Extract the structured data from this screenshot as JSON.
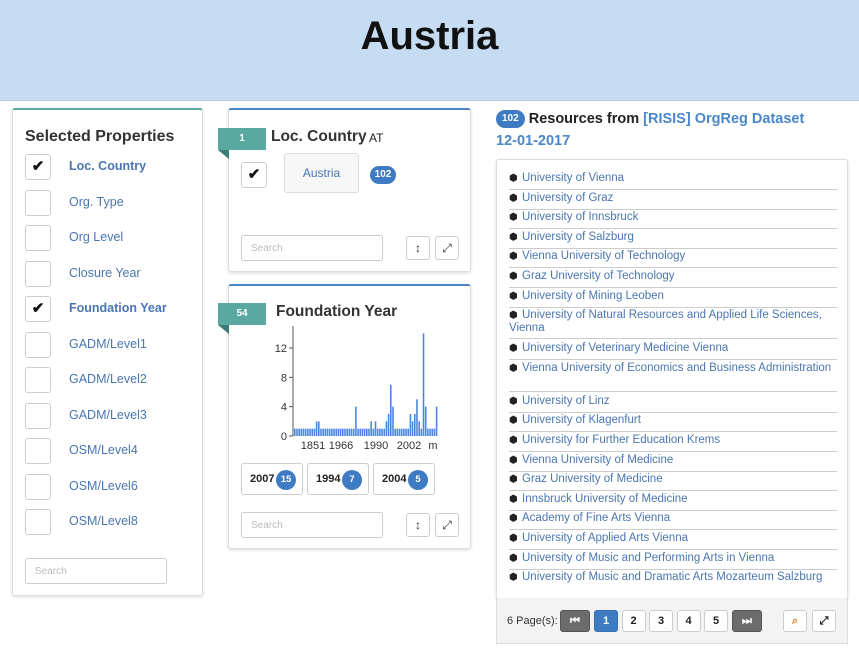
{
  "header": {
    "title": "Austria"
  },
  "properties": {
    "title": "Selected Properties",
    "search_placeholder": "Search",
    "items": [
      {
        "label": "Loc. Country",
        "checked": true
      },
      {
        "label": "Org. Type",
        "checked": false
      },
      {
        "label": "Org Level",
        "checked": false
      },
      {
        "label": "Closure Year",
        "checked": false
      },
      {
        "label": "Foundation Year",
        "checked": true
      },
      {
        "label": "GADM/Level1",
        "checked": false
      },
      {
        "label": "GADM/Level2",
        "checked": false
      },
      {
        "label": "GADM/Level3",
        "checked": false
      },
      {
        "label": "OSM/Level4",
        "checked": false
      },
      {
        "label": "OSM/Level6",
        "checked": false
      },
      {
        "label": "OSM/Level8",
        "checked": false
      }
    ]
  },
  "facet_country": {
    "badge": "1",
    "title": "Loc. Country",
    "subtitle": "AT",
    "value": "Austria",
    "count": "102",
    "search_placeholder": "Search"
  },
  "facet_year": {
    "badge": "54",
    "title": "Foundation Year",
    "search_placeholder": "Search",
    "buttons": [
      {
        "year": "2007",
        "count": "15"
      },
      {
        "year": "1994",
        "count": "7"
      },
      {
        "year": "2004",
        "count": "5"
      }
    ]
  },
  "chart_data": {
    "type": "bar",
    "title": "",
    "xlabel": "",
    "ylabel": "",
    "x_tick_labels": [
      "1851",
      "1966",
      "1990",
      "2002",
      "m"
    ],
    "y_ticks": [
      0,
      4,
      8,
      12
    ],
    "ylim": [
      0,
      15
    ],
    "values": [
      1,
      1,
      1,
      1,
      1,
      1,
      1,
      1,
      1,
      1,
      2,
      2,
      1,
      1,
      1,
      1,
      1,
      1,
      1,
      1,
      1,
      1,
      1,
      1,
      1,
      1,
      1,
      1,
      4,
      1,
      1,
      1,
      1,
      1,
      1,
      2,
      1,
      2,
      1,
      1,
      1,
      1,
      2,
      3,
      7,
      4,
      1,
      1,
      1,
      1,
      1,
      1,
      1,
      3,
      2,
      3,
      5,
      2,
      1,
      14,
      4,
      1,
      1,
      1,
      1,
      4
    ]
  },
  "resources": {
    "count": "102",
    "heading": "Resources from",
    "dataset_link": "[RISIS] OrgReg Dataset",
    "date": "12-01-2017",
    "items": [
      "University of Vienna",
      "University of Graz",
      "University of Innsbruck",
      "University of Salzburg",
      "Vienna University of Technology",
      "Graz University of Technology",
      "University of Mining Leoben",
      "University of Natural Resources and Applied Life Sciences, Vienna",
      "University of Veterinary Medicine Vienna",
      "Vienna University of Economics and Business Administration",
      "University of Linz",
      "University of Klagenfurt",
      "University for Further Education Krems",
      "Vienna University of Medicine",
      "Graz University of Medicine",
      "Innsbruck University of Medicine",
      "Academy of Fine Arts Vienna",
      "University of Applied Arts Vienna",
      "University of Music and Performing Arts in Vienna",
      "University of Music and Dramatic Arts Mozarteum Salzburg"
    ],
    "pager": {
      "label": "6 Page(s):",
      "pages": [
        "1",
        "2",
        "3",
        "4",
        "5"
      ],
      "active": "1"
    }
  },
  "icons": {
    "checkmark": "checkmark-icon",
    "resize": "vertical-resize-icon",
    "expand": "expand-icon",
    "cube": "cube-icon",
    "first": "first-page-icon",
    "last": "last-page-icon",
    "search": "search-icon"
  }
}
